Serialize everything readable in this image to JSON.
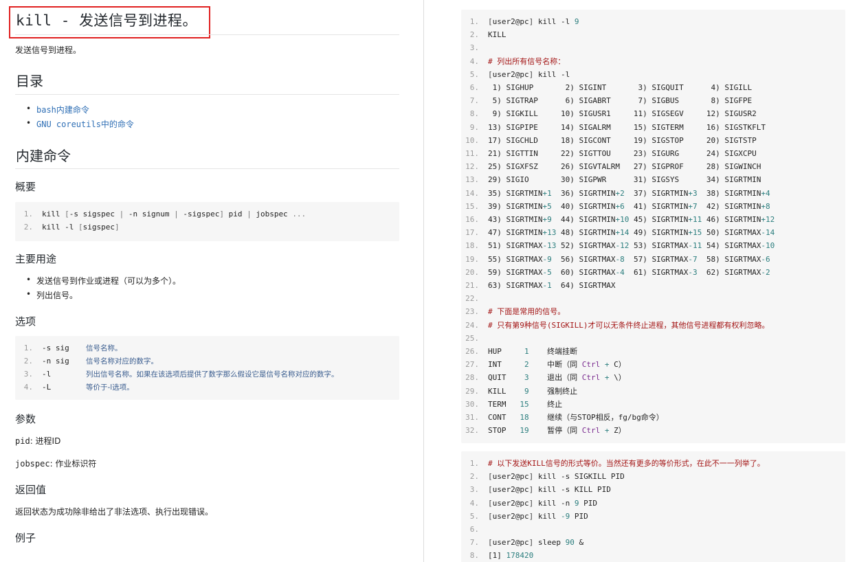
{
  "doc": {
    "title": "kill - 发送信号到进程。",
    "summary": "发送信号到进程。",
    "toc_heading": "目录",
    "toc": [
      "bash内建命令",
      "GNU coreutils中的命令"
    ],
    "builtin_heading": "内建命令",
    "overview_heading": "概要",
    "synopsis": [
      "kill [-s sigspec | -n signum | -sigspec] pid | jobspec ...",
      "kill -l [sigspec]"
    ],
    "usage_heading": "主要用途",
    "usage": [
      "发送信号到作业或进程（可以为多个）。",
      "列出信号。"
    ],
    "options_heading": "选项",
    "options": [
      {
        "flag": "-s sig",
        "desc": "信号名称。"
      },
      {
        "flag": "-n sig",
        "desc": "信号名称对应的数字。"
      },
      {
        "flag": "-l",
        "desc": "列出信号名称。如果在该选项后提供了数字那么假设它是信号名称对应的数字。"
      },
      {
        "flag": "-L",
        "desc": "等价于-l选项。"
      }
    ],
    "params_heading": "参数",
    "params": [
      {
        "name": "pid",
        "desc": ": 进程ID"
      },
      {
        "name": "jobspec",
        "desc": ": 作业标识符"
      }
    ],
    "return_heading": "返回值",
    "return_text": "返回状态为成功除非给出了非法选项、执行出现错误。",
    "examples_heading": "例子"
  },
  "code1": [
    "[user2@pc] kill -l 9",
    "KILL",
    "",
    "# 列出所有信号名称：",
    "[user2@pc] kill -l",
    " 1) SIGHUP       2) SIGINT       3) SIGQUIT      4) SIGILL",
    " 5) SIGTRAP      6) SIGABRT      7) SIGBUS       8) SIGFPE",
    " 9) SIGKILL     10) SIGUSR1     11) SIGSEGV     12) SIGUSR2",
    "13) SIGPIPE     14) SIGALRM     15) SIGTERM     16) SIGSTKFLT",
    "17) SIGCHLD     18) SIGCONT     19) SIGSTOP     20) SIGTSTP",
    "21) SIGTTIN     22) SIGTTOU     23) SIGURG      24) SIGXCPU",
    "25) SIGXFSZ     26) SIGVTALRM   27) SIGPROF     28) SIGWINCH",
    "29) SIGIO       30) SIGPWR      31) SIGSYS      34) SIGRTMIN",
    "35) SIGRTMIN+1  36) SIGRTMIN+2  37) SIGRTMIN+3  38) SIGRTMIN+4",
    "39) SIGRTMIN+5  40) SIGRTMIN+6  41) SIGRTMIN+7  42) SIGRTMIN+8",
    "43) SIGRTMIN+9  44) SIGRTMIN+10 45) SIGRTMIN+11 46) SIGRTMIN+12",
    "47) SIGRTMIN+13 48) SIGRTMIN+14 49) SIGRTMIN+15 50) SIGRTMAX-14",
    "51) SIGRTMAX-13 52) SIGRTMAX-12 53) SIGRTMAX-11 54) SIGRTMAX-10",
    "55) SIGRTMAX-9  56) SIGRTMAX-8  57) SIGRTMAX-7  58) SIGRTMAX-6",
    "59) SIGRTMAX-5  60) SIGRTMAX-4  61) SIGRTMAX-3  62) SIGRTMAX-2",
    "63) SIGRTMAX-1  64) SIGRTMAX",
    "",
    "# 下面是常用的信号。",
    "# 只有第9种信号(SIGKILL)才可以无条件终止进程，其他信号进程都有权利忽略。",
    "",
    "HUP     1    终端挂断",
    "INT     2    中断（同 Ctrl + C）",
    "QUIT    3    退出（同 Ctrl + \\）",
    "KILL    9    强制终止",
    "TERM   15    终止",
    "CONT   18    继续（与STOP相反，fg/bg命令）",
    "STOP   19    暂停（同 Ctrl + Z）"
  ],
  "code2": [
    "# 以下发送KILL信号的形式等价。当然还有更多的等价形式，在此不一一列举了。",
    "[user2@pc] kill -s SIGKILL PID",
    "[user2@pc] kill -s KILL PID",
    "[user2@pc] kill -n 9 PID",
    "[user2@pc] kill -9 PID",
    "",
    "[user2@pc] sleep 90 &",
    "[1] 178420"
  ],
  "colors": {
    "highlight_box": "#e02020",
    "link": "#2f6fb5",
    "comment": "#a31515",
    "number": "#2a7d7d",
    "code_bg": "#f6f6f6"
  }
}
